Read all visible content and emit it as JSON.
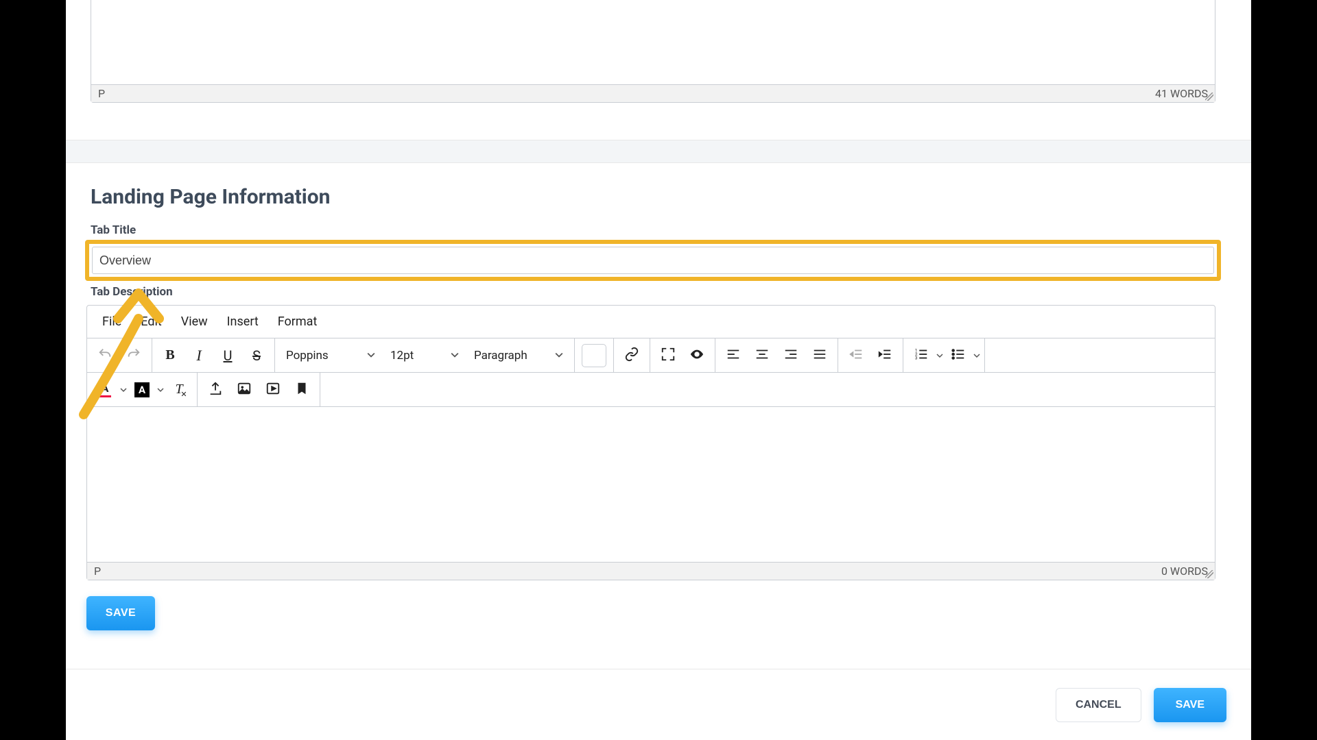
{
  "upper_editor": {
    "path_indicator": "P",
    "word_count_label": "41 WORDS"
  },
  "section_title": "Landing Page Information",
  "tab_title_label": "Tab Title",
  "tab_title_value": "Overview",
  "tab_desc_label": "Tab Description",
  "menubar": {
    "file": "File",
    "edit": "Edit",
    "view": "View",
    "insert": "Insert",
    "format": "Format"
  },
  "toolbar": {
    "bold": "B",
    "italic": "I",
    "under": "U",
    "strike": "S",
    "font_family": "Poppins",
    "font_size": "12pt",
    "block_format": "Paragraph",
    "text_color_letter": "A",
    "bg_color_letter": "A"
  },
  "lower_editor": {
    "path_indicator": "P",
    "word_count_label": "0 WORDS"
  },
  "buttons": {
    "save_small": "SAVE",
    "cancel": "CANCEL",
    "save_footer": "SAVE"
  }
}
